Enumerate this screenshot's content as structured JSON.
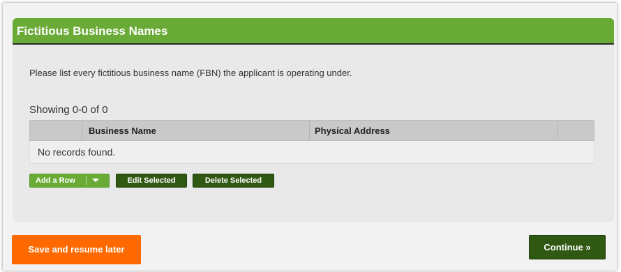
{
  "section": {
    "title": "Fictitious Business Names",
    "instructions": "Please list every fictitious business name (FBN) the applicant is operating under."
  },
  "grid": {
    "showing": "Showing 0-0 of 0",
    "columns": [
      "",
      "Business Name",
      "Physical Address",
      ""
    ],
    "empty_message": "No records found."
  },
  "actions": {
    "add_row": "Add a Row",
    "edit_selected": "Edit Selected",
    "delete_selected": "Delete Selected"
  },
  "footer": {
    "save_resume": "Save and resume later",
    "continue": "Continue »"
  },
  "colors": {
    "header_green": "#6aab37",
    "dark_green": "#2f5812",
    "orange": "#ff6a00"
  }
}
